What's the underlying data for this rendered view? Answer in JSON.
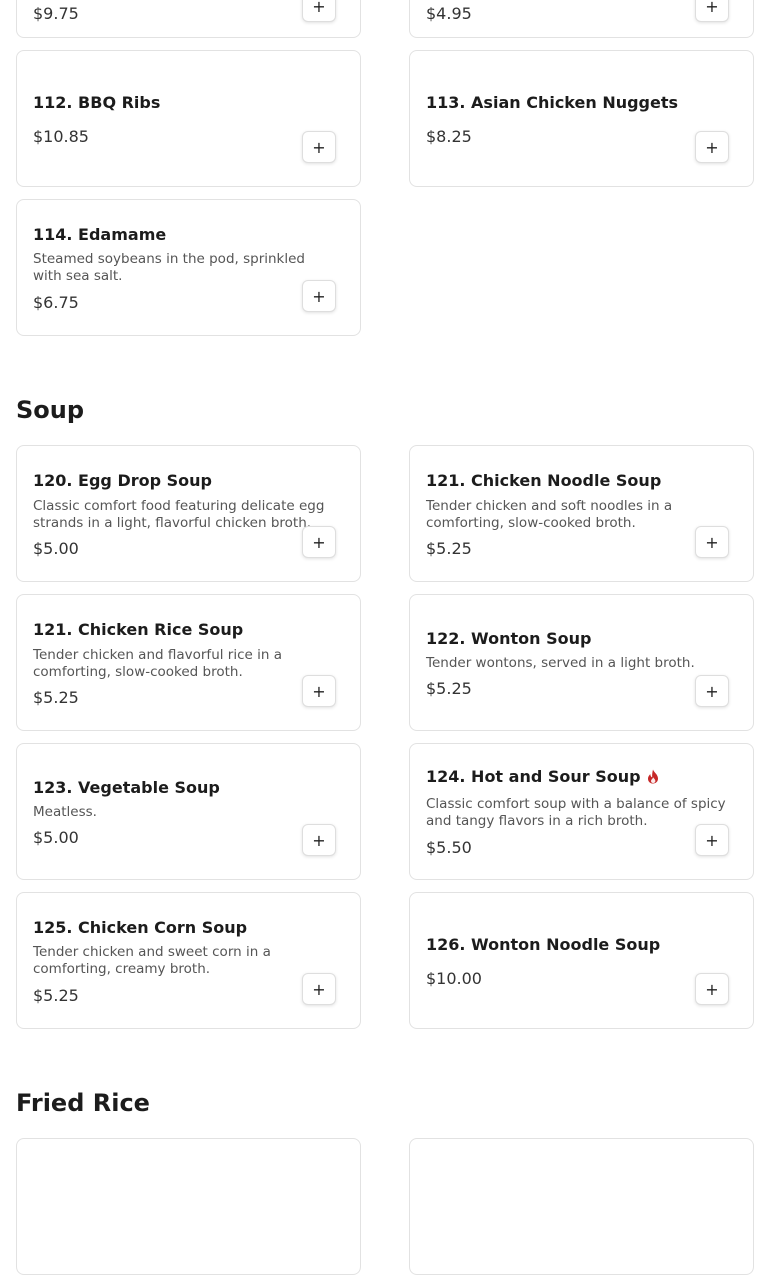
{
  "add_label": "+",
  "accent_color": "#c62828",
  "top_cards": [
    {
      "price": "$9.75"
    },
    {
      "price": "$4.95"
    }
  ],
  "appetizers": [
    {
      "name": "112. BBQ Ribs",
      "price": "$10.85"
    },
    {
      "name": "113. Asian Chicken Nuggets",
      "price": "$8.25"
    },
    {
      "name": "114. Edamame",
      "desc": "Steamed soybeans in the pod, sprinkled with sea salt.",
      "price": "$6.75"
    }
  ],
  "soup": {
    "title": "Soup",
    "items": [
      {
        "name": "120. Egg Drop Soup",
        "desc": "Classic comfort food featuring delicate egg strands in a light, flavorful chicken broth.",
        "price": "$5.00"
      },
      {
        "name": "121. Chicken Noodle Soup",
        "desc": "Tender chicken and soft noodles in a comforting, slow-cooked broth.",
        "price": "$5.25"
      },
      {
        "name": "121. Chicken Rice Soup",
        "desc": "Tender chicken and flavorful rice in a comforting, slow-cooked broth.",
        "price": "$5.25"
      },
      {
        "name": "122. Wonton Soup",
        "desc": "Tender wontons, served in a light broth.",
        "price": "$5.25"
      },
      {
        "name": "123. Vegetable Soup",
        "desc": "Meatless.",
        "price": "$5.00"
      },
      {
        "name": "124. Hot and Sour Soup",
        "desc": "Classic comfort soup with a balance of spicy and tangy flavors in a rich broth.",
        "price": "$5.50",
        "icon": "spicy-flame-icon"
      },
      {
        "name": "125. Chicken Corn Soup",
        "desc": "Tender chicken and sweet corn in a comforting, creamy broth.",
        "price": "$5.25"
      },
      {
        "name": "126. Wonton Noodle Soup",
        "price": "$10.00"
      }
    ]
  },
  "fried_rice": {
    "title": "Fried Rice"
  }
}
